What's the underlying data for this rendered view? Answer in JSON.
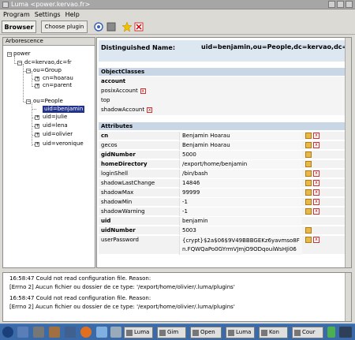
{
  "window": {
    "title": "Luma <power.kervao.fr>"
  },
  "menu": [
    "Program",
    "Settings",
    "Help"
  ],
  "toolbar": {
    "browser_tab": "Browser",
    "choose_plugin": "Choose plugin"
  },
  "tree": {
    "header": "Arborescence",
    "nodes": [
      {
        "label": "power"
      },
      {
        "label": "dc=kervao,dc=fr"
      },
      {
        "label": "ou=Group"
      },
      {
        "label": "cn=hoarau"
      },
      {
        "label": "cn=parent"
      },
      {
        "label": "ou=People"
      },
      {
        "label": "uid=benjamin"
      },
      {
        "label": "uid=julie"
      },
      {
        "label": "uid=lena"
      },
      {
        "label": "uid=olivier"
      },
      {
        "label": "uid=veronique"
      }
    ]
  },
  "detail": {
    "dn_label": "Distinguished Name:",
    "dn_value": "uid=benjamin,ou=People,dc=kervao,dc=fr",
    "objectclasses_header": "ObjectClasses",
    "objectclasses": [
      "account",
      "posixAccount",
      "top",
      "shadowAccount"
    ],
    "attributes_header": "Attributes",
    "attributes": [
      {
        "name": "cn",
        "value": "Benjamin Hoarau"
      },
      {
        "name": "gecos",
        "value": "Benjamin Hoarau"
      },
      {
        "name": "gidNumber",
        "value": "5000"
      },
      {
        "name": "homeDirectory",
        "value": "/export/home/benjamin"
      },
      {
        "name": "loginShell",
        "value": "/bin/bash"
      },
      {
        "name": "shadowLastChange",
        "value": "14846"
      },
      {
        "name": "shadowMax",
        "value": "99999"
      },
      {
        "name": "shadowMin",
        "value": "-1"
      },
      {
        "name": "shadowWarning",
        "value": "-1"
      },
      {
        "name": "uid",
        "value": "benjamin"
      },
      {
        "name": "uidNumber",
        "value": "5003"
      },
      {
        "name": "userPassword",
        "value_line1": "{crypt}$2a$06$9V49BBBGEKz6yavmso8F",
        "value_line2": "n.FQWQaPo0GYrmVJmjO9ODqouiWsHJi06"
      }
    ]
  },
  "log": {
    "line1": "16:58:47     Could not read configuration file. Reason:",
    "line2": "[Errno 2] Aucun fichier ou dossier de ce type: '/export/home/olivier/.luma/plugins'",
    "line3": "16:58:47     Could not read configuration file. Reason:",
    "line4": "[Errno 2] Aucun fichier ou dossier de ce type: '/export/home/olivier/.luma/plugins'"
  },
  "taskbar": {
    "items": [
      "Luma",
      "Gim",
      "Open",
      "Luma",
      "Kon",
      "Cour"
    ]
  }
}
